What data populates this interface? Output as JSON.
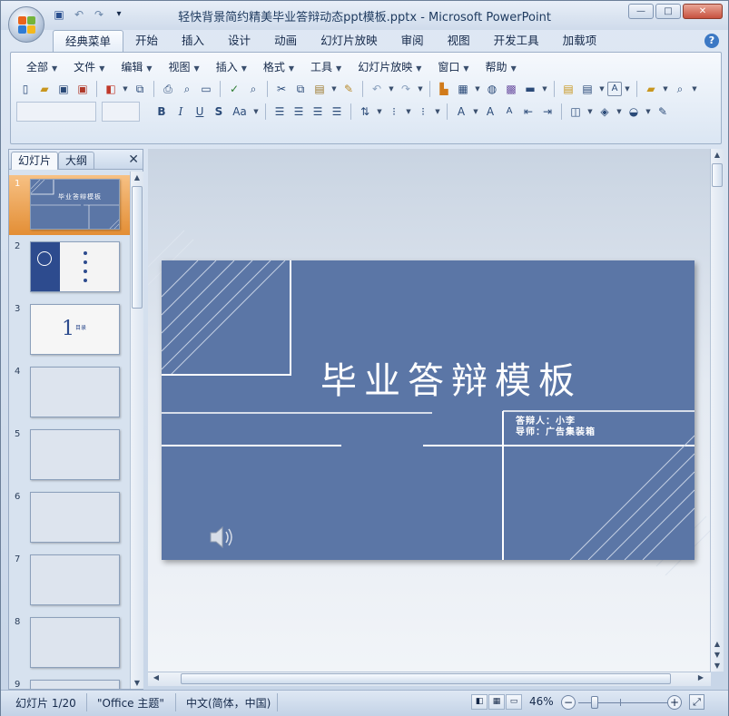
{
  "window": {
    "title": "轻快背景简约精美毕业答辩动态ppt模板.pptx - Microsoft PowerPoint",
    "controls": {
      "minimize": "—",
      "maximize": "□",
      "close": "✕"
    }
  },
  "quick_access": {
    "save": "save-icon",
    "undo": "undo-icon",
    "redo": "redo-icon",
    "customize": "▾"
  },
  "ribbon_tabs": [
    {
      "label": "经典菜单"
    },
    {
      "label": "开始"
    },
    {
      "label": "插入"
    },
    {
      "label": "设计"
    },
    {
      "label": "动画"
    },
    {
      "label": "幻灯片放映"
    },
    {
      "label": "审阅"
    },
    {
      "label": "视图"
    },
    {
      "label": "开发工具"
    },
    {
      "label": "加载项"
    }
  ],
  "help": "?",
  "classic_menus": [
    {
      "label": "全部"
    },
    {
      "label": "文件"
    },
    {
      "label": "编辑"
    },
    {
      "label": "视图"
    },
    {
      "label": "插入"
    },
    {
      "label": "格式"
    },
    {
      "label": "工具"
    },
    {
      "label": "幻灯片放映"
    },
    {
      "label": "窗口"
    },
    {
      "label": "帮助"
    }
  ],
  "font_name_box": "",
  "font_size_box": "",
  "pane_tabs": {
    "slides": "幻灯片",
    "outline": "大纲",
    "close": "✕"
  },
  "thumbnails": [
    {
      "num": "1",
      "title": "毕业答辩模板"
    },
    {
      "num": "2"
    },
    {
      "num": "3",
      "big": "1",
      "small": "目录"
    },
    {
      "num": "4"
    },
    {
      "num": "5"
    },
    {
      "num": "6"
    },
    {
      "num": "7"
    },
    {
      "num": "8"
    },
    {
      "num": "9"
    }
  ],
  "slide": {
    "title": "毕业答辩模板",
    "presenter": "答辩人：小李",
    "advisor": "导师：广告集装箱",
    "background_color": "#5b76a6",
    "audio": "speaker-icon"
  },
  "status": {
    "slide_info": "幻灯片 1/20",
    "theme": "\"Office 主题\"",
    "language": "中文(简体，中国)",
    "zoom": "46%",
    "zoom_out": "−",
    "zoom_in": "+"
  }
}
